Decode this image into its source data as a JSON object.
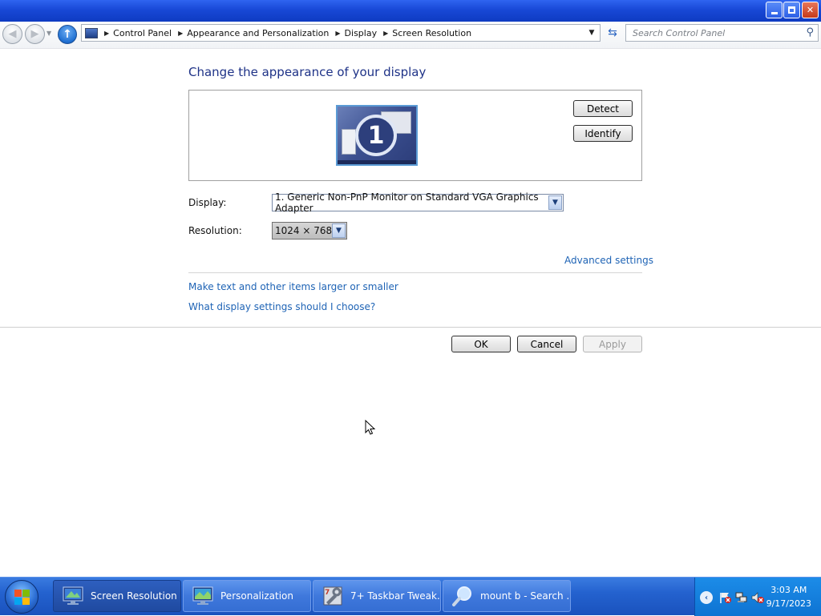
{
  "navigation": {
    "breadcrumbs": [
      "Control Panel",
      "Appearance and Personalization",
      "Display",
      "Screen Resolution"
    ],
    "search_placeholder": "Search Control Panel"
  },
  "content": {
    "heading": "Change the appearance of your display",
    "monitor_number": "1",
    "detect_label": "Detect",
    "identify_label": "Identify",
    "display_label": "Display:",
    "display_value": "1. Generic Non-PnP Monitor on Standard VGA Graphics Adapter",
    "resolution_label": "Resolution:",
    "resolution_value": "1024 × 768",
    "advanced_link": "Advanced settings",
    "links": [
      "Make text and other items larger or smaller",
      "What display settings should I choose?"
    ],
    "ok_label": "OK",
    "cancel_label": "Cancel",
    "apply_label": "Apply"
  },
  "taskbar": {
    "tasks": [
      {
        "label": "Screen Resolution",
        "icon": "display-settings-icon",
        "active": true
      },
      {
        "label": "Personalization",
        "icon": "personalization-icon",
        "active": false
      },
      {
        "label": "7+ Taskbar Tweak...",
        "icon": "taskbar-tweaker-icon",
        "active": false
      },
      {
        "label": "mount b - Search ...",
        "icon": "search-magnifier-icon",
        "active": false
      }
    ],
    "clock_time": "3:03 AM",
    "clock_date": "9/17/2023"
  },
  "colors": {
    "link": "#1e63b5",
    "heading": "#1e3287",
    "titlebar": "#1848d6",
    "taskbar": "#2462cf"
  }
}
